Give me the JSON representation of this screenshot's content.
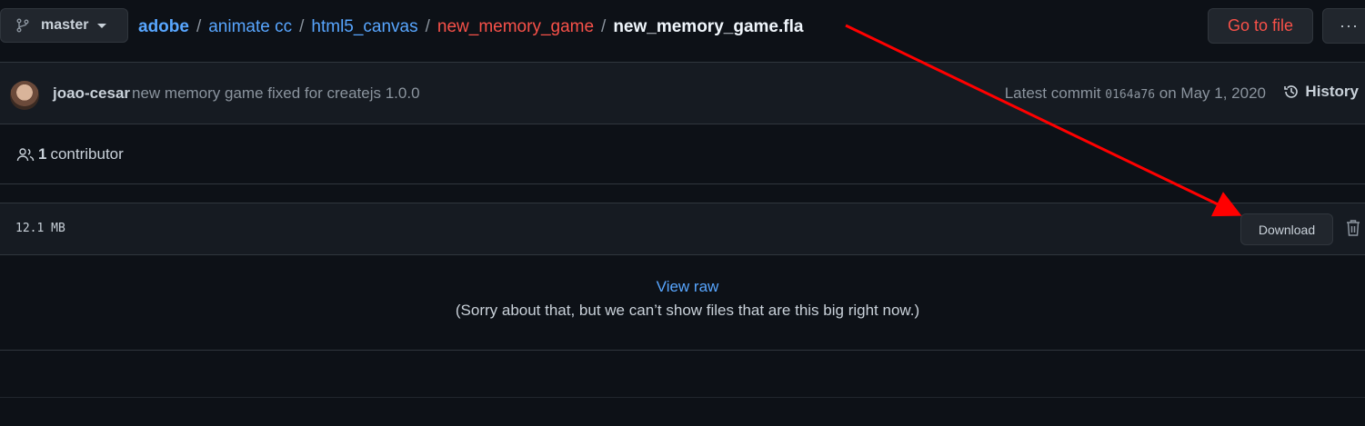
{
  "branch": {
    "label": "master",
    "icon": "git-branch-icon",
    "caret_icon": "chevron-down-icon"
  },
  "breadcrumb": {
    "segments": [
      "adobe",
      "animate cc",
      "html5_canvas",
      "new_memory_game"
    ],
    "separator": "/",
    "current": "new_memory_game.fla"
  },
  "toolbar": {
    "goto_label": "Go to file",
    "more_label": "···"
  },
  "commit": {
    "author": "joao-cesar",
    "message": "new memory game fixed for createjs 1.0.0",
    "latest_prefix": "Latest commit",
    "sha": "0164a76",
    "date_text": "on May 1, 2020",
    "history_label": "History"
  },
  "contributors": {
    "count": "1",
    "label": "contributor"
  },
  "file": {
    "size": "12.1 MB",
    "download_label": "Download",
    "view_raw_label": "View raw",
    "too_big_message": "(Sorry about that, but we can’t show files that are this big right now.)"
  },
  "colors": {
    "background": "#0d1117",
    "link": "#58a6ff",
    "danger": "#f85149",
    "arrow": "#ff0000"
  }
}
